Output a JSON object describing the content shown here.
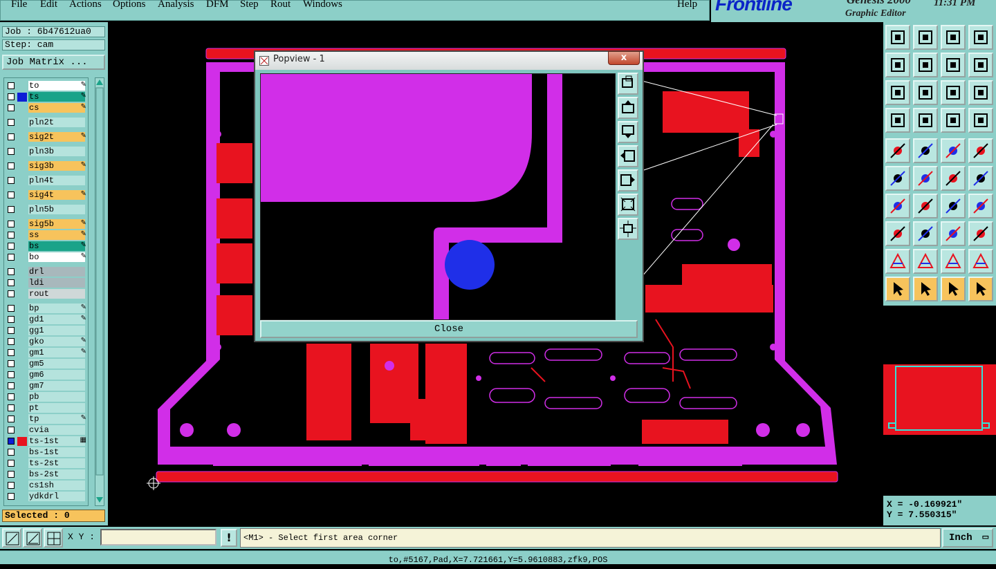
{
  "menu": {
    "items": [
      "File",
      "Edit",
      "Actions",
      "Options",
      "Analysis",
      "DFM",
      "Step",
      "Rout",
      "Windows"
    ],
    "help": "Help"
  },
  "brand": {
    "logo": "Frontline",
    "product": "Genesis 2000",
    "subtitle": "Graphic Editor",
    "time": "11:31 PM"
  },
  "job": {
    "job_label": "Job : 6b47612ua0",
    "step_label": "Step: cam",
    "job_matrix_button": "Job Matrix ..."
  },
  "layers": [
    {
      "name": "to",
      "bg": "#ffffff",
      "flag": "✎"
    },
    {
      "name": "ts",
      "bg": "#1aa389",
      "flag": "✎",
      "color": "#0d1ed6"
    },
    {
      "name": "cs",
      "bg": "#f7c35c",
      "flag": "✎"
    },
    {
      "name": "pln2t",
      "bg": "#b5e3dd",
      "flag": ""
    },
    {
      "name": "sig2t",
      "bg": "#f7c35c",
      "flag": "✎"
    },
    {
      "name": "pln3b",
      "bg": "#b5e3dd",
      "flag": ""
    },
    {
      "name": "sig3b",
      "bg": "#f7c35c",
      "flag": "✎"
    },
    {
      "name": "pln4t",
      "bg": "#b5e3dd",
      "flag": ""
    },
    {
      "name": "sig4t",
      "bg": "#f7c35c",
      "flag": "✎"
    },
    {
      "name": "pln5b",
      "bg": "#b5e3dd",
      "flag": ""
    },
    {
      "name": "sig5b",
      "bg": "#f7c35c",
      "flag": "✎"
    },
    {
      "name": "ss",
      "bg": "#f7c35c",
      "flag": "✎"
    },
    {
      "name": "bs",
      "bg": "#1aa389",
      "flag": "✎"
    },
    {
      "name": "bo",
      "bg": "#ffffff",
      "flag": "✎"
    },
    {
      "name": "drl",
      "bg": "#a8b8bc",
      "flag": ""
    },
    {
      "name": "ldi",
      "bg": "#a8b8bc",
      "flag": ""
    },
    {
      "name": "rout",
      "bg": "#cfd8d8",
      "flag": ""
    },
    {
      "name": "bp",
      "bg": "#b5e3dd",
      "flag": "✎"
    },
    {
      "name": "gd1",
      "bg": "#b5e3dd",
      "flag": "✎"
    },
    {
      "name": "gg1",
      "bg": "#b5e3dd",
      "flag": ""
    },
    {
      "name": "gko",
      "bg": "#b5e3dd",
      "flag": "✎"
    },
    {
      "name": "gm1",
      "bg": "#b5e3dd",
      "flag": "✎"
    },
    {
      "name": "gm5",
      "bg": "#b5e3dd",
      "flag": ""
    },
    {
      "name": "gm6",
      "bg": "#b5e3dd",
      "flag": ""
    },
    {
      "name": "gm7",
      "bg": "#b5e3dd",
      "flag": ""
    },
    {
      "name": "pb",
      "bg": "#b5e3dd",
      "flag": ""
    },
    {
      "name": "pt",
      "bg": "#b5e3dd",
      "flag": ""
    },
    {
      "name": "tp",
      "bg": "#b5e3dd",
      "flag": "✎"
    },
    {
      "name": "cvia",
      "bg": "#b5e3dd",
      "flag": ""
    },
    {
      "name": "ts-1st",
      "bg": "#b5e3dd",
      "flag": "▦",
      "color": "#e8131f",
      "active": true
    },
    {
      "name": "bs-1st",
      "bg": "#b5e3dd",
      "flag": ""
    },
    {
      "name": "ts-2st",
      "bg": "#b5e3dd",
      "flag": ""
    },
    {
      "name": "bs-2st",
      "bg": "#b5e3dd",
      "flag": ""
    },
    {
      "name": "cs1sh",
      "bg": "#b5e3dd",
      "flag": ""
    },
    {
      "name": "ydkdrl",
      "bg": "#b5e3dd",
      "flag": ""
    }
  ],
  "selected": "Selected : 0",
  "popup": {
    "title": "Popview - 1",
    "close_x": "x",
    "close_button": "Close"
  },
  "coords": {
    "x": "X = -0.169921\"",
    "y": "Y = 7.550315\""
  },
  "command": {
    "xy_label": "X Y :",
    "xy_value": "",
    "alert_icon": "!",
    "prompt": "<M1> - Select first area corner",
    "units": "Inch"
  },
  "status": "to,#5167,Pad,X=7.721661,Y=5.9610883,zfk9,POS",
  "colors": {
    "panel": "#8ccfc8",
    "copper": "#e8131f",
    "mask": "#d12ee8",
    "accent_blue": "#1f2fe8",
    "highlight": "#f7c35c"
  }
}
